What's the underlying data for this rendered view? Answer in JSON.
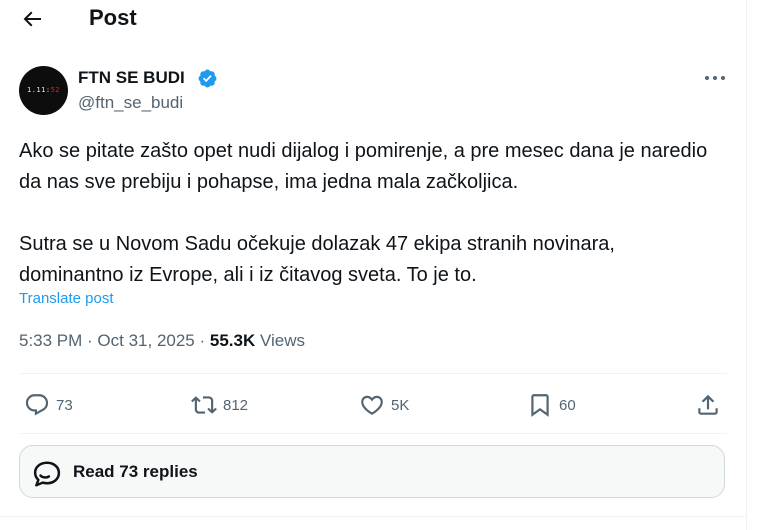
{
  "header": {
    "title": "Post"
  },
  "author": {
    "name": "FTN SE BUDI",
    "handle": "@ftn_se_budi",
    "avatar_text_white": "1.11:",
    "avatar_text_red": "52"
  },
  "tweet": {
    "paragraphs": [
      "Ako se pitate zašto opet nudi dijalog i pomirenje, a pre mesec dana je naredio da nas sve prebiju i pohapse, ima jedna mala začkoljica.",
      "Sutra se u Novom Sadu očekuje dolazak 47 ekipa stranih novinara, dominantno iz Evrope, ali i iz čitavog sveta. To je to."
    ],
    "translate_label": "Translate post",
    "time": "5:33 PM",
    "separator": " · ",
    "date": "Oct 31, 2025",
    "views_count": "55.3K",
    "views_label": "Views"
  },
  "actions": {
    "replies": "73",
    "reposts": "812",
    "likes": "5K",
    "bookmarks": "60"
  },
  "read_replies_label": "Read 73 replies",
  "colors": {
    "accent": "#1d9bf0",
    "secondary_text": "#536471",
    "primary_text": "#0f1419"
  }
}
